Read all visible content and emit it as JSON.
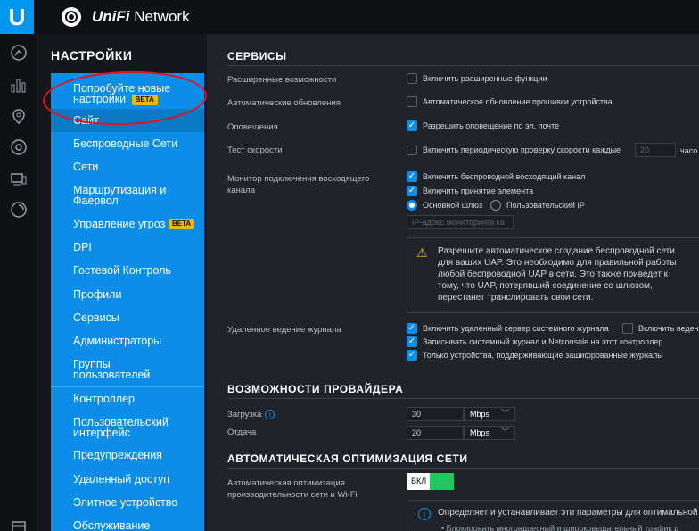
{
  "topbar": {
    "logo_letter": "U",
    "app_brand": "UniFi",
    "app_name": " Network"
  },
  "rail": {
    "icons": [
      "dashboard-icon",
      "statistics-icon",
      "map-icon",
      "devices-icon",
      "clients-icon",
      "insights-icon"
    ]
  },
  "panel": {
    "title": "НАСТРОЙКИ",
    "items": [
      {
        "label": "Попробуйте новые настройки",
        "badge": "BETA"
      },
      {
        "label": "Сайт"
      },
      {
        "label": "Беспроводные Сети"
      },
      {
        "label": "Сети"
      },
      {
        "label": "Маршрутизация и Фаервол"
      },
      {
        "label": "Управление угрозами",
        "badge": "BETA"
      },
      {
        "label": "DPI"
      },
      {
        "label": "Гостевой Контроль"
      },
      {
        "label": "Профили"
      },
      {
        "label": "Сервисы"
      },
      {
        "label": "Администраторы"
      },
      {
        "label": "Группы пользователей"
      },
      {
        "label": "Контроллер"
      },
      {
        "label": "Пользовательский интерфейс"
      },
      {
        "label": "Предупреждения"
      },
      {
        "label": "Удаленный доступ"
      },
      {
        "label": "Элитное устройство"
      },
      {
        "label": "Обслуживание"
      }
    ]
  },
  "services": {
    "title": "СЕРВИСЫ",
    "advanced_label": "Расширенные возможности",
    "advanced_opt": "Включить расширенные функции",
    "autoupdate_label": "Автоматические обновления",
    "autoupdate_opt": "Автоматическое обновление прошивки устройства",
    "alerts_label": "Оповещения",
    "alerts_opt": "Разрешить оповещение по эл. почте",
    "speedtest_label": "Тест скорости",
    "speedtest_opt": "Включить периодическую проверку скорости каждые",
    "speedtest_value": "20",
    "speedtest_unit": "часо",
    "uplink_label": "Монитор подключения восходящего канала",
    "uplink_opt1": "Включить беспроводной восходящий канал",
    "uplink_opt2": "Включить принятие элемента",
    "radio_gateway": "Основной шлюз",
    "radio_custom": "Пользовательский IP",
    "ip_placeholder": "IP-адрес мониторинга ка",
    "warning_text": "Разрешите автоматическое создание беспроводной сети для ваших UAP. Это необходимо для правильной работы любой беспроводной UAP в сети. Это также приведет к тому, что UAP, потерявший соединение со шлюзом, перестанет транслировать свои сети.",
    "logging_label": "Удаленное ведение журнала",
    "logging_opt1": "Включить удаленный сервер системного журнала",
    "logging_opt1b": "Включить веден",
    "logging_opt2": "Записывать системный журнал и Netconsole на этот контроллер",
    "logging_opt3": "Только устройства, поддерживающие зашифрованные журналы"
  },
  "isp": {
    "title": "ВОЗМОЖНОСТИ ПРОВАЙДЕРА",
    "download_label": "Загрузка",
    "download_value": "30",
    "download_unit": "Mbps",
    "upload_label": "Отдача",
    "upload_value": "20",
    "upload_unit": "Mbps"
  },
  "optimization": {
    "title": "АВТОМАТИЧЕСКАЯ ОПТИМИЗАЦИЯ СЕТИ",
    "label": "Автоматическая оптимизация производительности сети и Wi-Fi",
    "toggle_label": "ВКЛ",
    "info_text": "Определяет и устанавливает эти параметры для оптимальной",
    "info_bullet": "• Блокировать многоадресный и широковещательный трафик д"
  },
  "colors": {
    "accent": "#0c8ee8",
    "brand": "#0096f0",
    "toggle_on": "#22c55e",
    "beta": "#f5b800",
    "highlight": "#e8101c"
  }
}
